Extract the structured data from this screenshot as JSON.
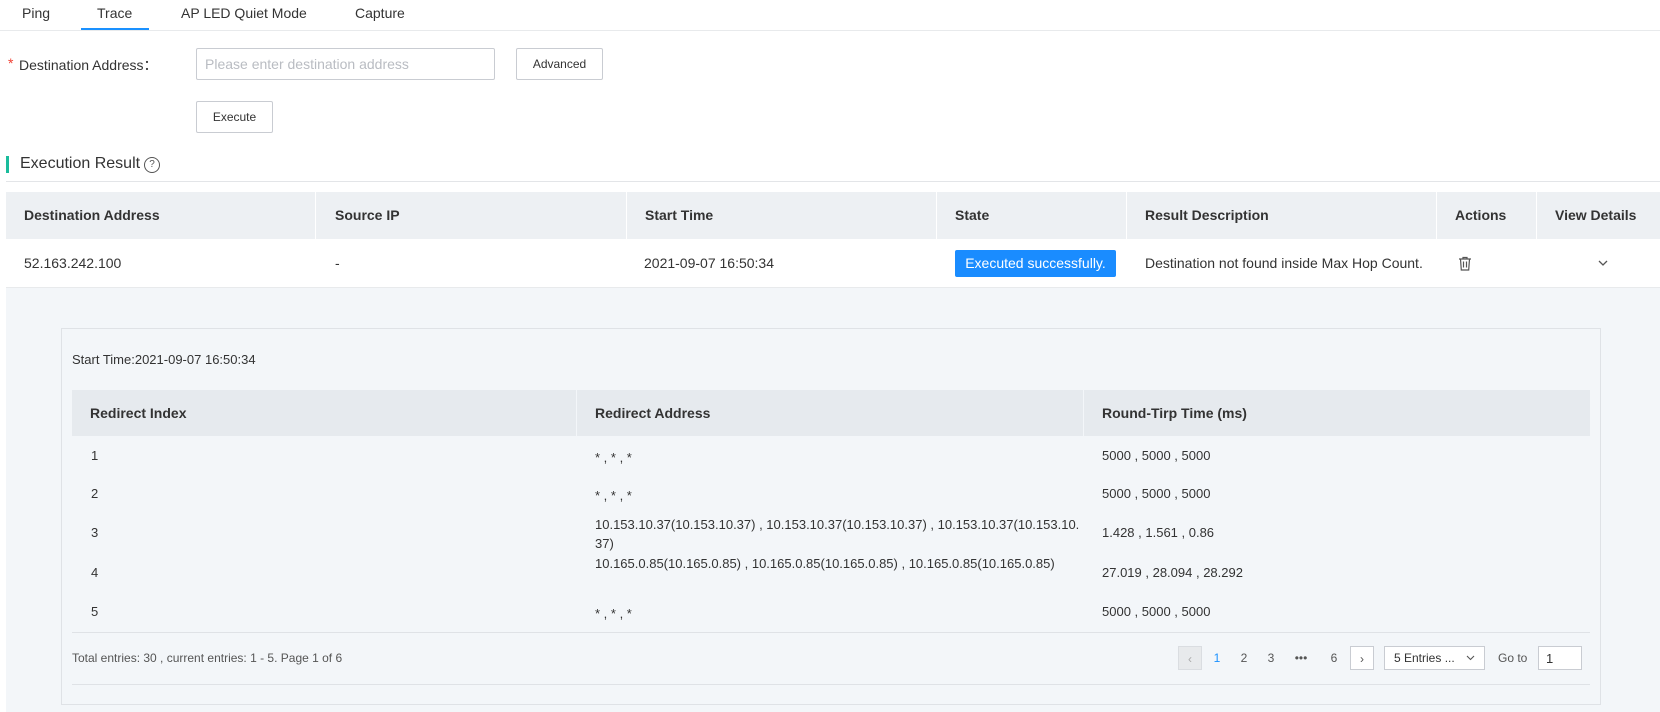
{
  "tabs": [
    {
      "label": "Ping"
    },
    {
      "label": "Trace",
      "active": true
    },
    {
      "label": "AP LED Quiet Mode"
    },
    {
      "label": "Capture"
    }
  ],
  "form": {
    "required_mark": "*",
    "destination_label": "Destination Address：",
    "destination_placeholder": "Please enter destination address",
    "destination_value": "",
    "advanced_label": "Advanced",
    "execute_label": "Execute"
  },
  "section": {
    "title": "Execution Result",
    "help_glyph": "?"
  },
  "result_table": {
    "headers": [
      "Destination Address",
      "Source IP",
      "Start Time",
      "State",
      "Result Description",
      "Actions",
      "View Details"
    ],
    "rows": [
      {
        "destination": "52.163.242.100",
        "source_ip": "-",
        "start_time": "2021-09-07 16:50:34",
        "state": "Executed successfully.",
        "description": "Destination not found inside Max Hop Count.",
        "actions_icon": "trash-icon",
        "details_icon": "chevron-down-icon"
      }
    ]
  },
  "details": {
    "start_time_text": "Start Time:2021-09-07 16:50:34",
    "headers": [
      "Redirect Index",
      "Redirect Address",
      "Round-Tirp Time (ms)"
    ],
    "rows": [
      {
        "index": "1",
        "address": "* , * , *",
        "rtt": "5000 , 5000 , 5000"
      },
      {
        "index": "2",
        "address": "* , * , *",
        "rtt": "5000 , 5000 , 5000"
      },
      {
        "index": "3",
        "address": "10.153.10.37(10.153.10.37) , 10.153.10.37(10.153.10.37) , 10.153.10.37(10.153.10.37)",
        "rtt": "1.428 , 1.561 , 0.86"
      },
      {
        "index": "4",
        "address": "10.165.0.85(10.165.0.85) , 10.165.0.85(10.165.0.85) , 10.165.0.85(10.165.0.85)",
        "rtt": "27.019 , 28.094 , 28.292"
      },
      {
        "index": "5",
        "address": "* , * , *",
        "rtt": "5000 , 5000 , 5000"
      }
    ],
    "total_text": "Total entries: 30 , current entries: 1 - 5. Page 1 of 6"
  },
  "pagination": {
    "pages": [
      "1",
      "2",
      "3",
      "•••",
      "6"
    ],
    "current_page": "1",
    "page_size_label": "5 Entries ...",
    "goto_label": "Go to",
    "goto_value": "1"
  },
  "colors": {
    "accent": "#1a91ff",
    "success_badge": "#1a8cff",
    "section_bar": "#1abc9c",
    "required": "#f04134"
  }
}
